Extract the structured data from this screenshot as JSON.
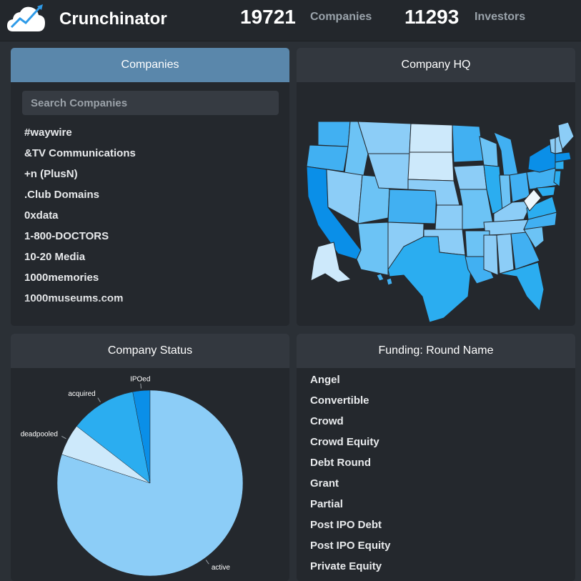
{
  "header": {
    "app_title": "Crunchinator",
    "companies_count": "19721",
    "companies_label": "Companies",
    "investors_count": "11293",
    "investors_label": "Investors"
  },
  "companies_panel": {
    "title": "Companies",
    "search_placeholder": "Search Companies",
    "items": [
      "#waywire",
      "&TV Communications",
      "+n (PlusN)",
      ".Club Domains",
      "0xdata",
      "1-800-DOCTORS",
      "10-20 Media",
      "1000memories",
      "1000museums.com"
    ]
  },
  "hq_panel": {
    "title": "Company HQ"
  },
  "status_panel": {
    "title": "Company Status"
  },
  "funding_panel": {
    "title": "Funding: Round Name",
    "items": [
      "Angel",
      "Convertible",
      "Crowd",
      "Crowd Equity",
      "Debt Round",
      "Grant",
      "Partial",
      "Post IPO Debt",
      "Post IPO Equity",
      "Private Equity"
    ]
  },
  "colors": {
    "accent_header": "#5a87ab",
    "active": "#8ccdf7",
    "deadpooled": "#cde9fb",
    "acquired": "#2badf0",
    "ipoed": "#0a8fe8"
  },
  "chart_data": {
    "type": "pie",
    "labels": [
      "active",
      "deadpooled",
      "acquired",
      "IPOed"
    ],
    "values": [
      80,
      5.5,
      11.5,
      3
    ],
    "colors": [
      "#8ccdf7",
      "#cde9fb",
      "#2badf0",
      "#0a8fe8"
    ]
  }
}
